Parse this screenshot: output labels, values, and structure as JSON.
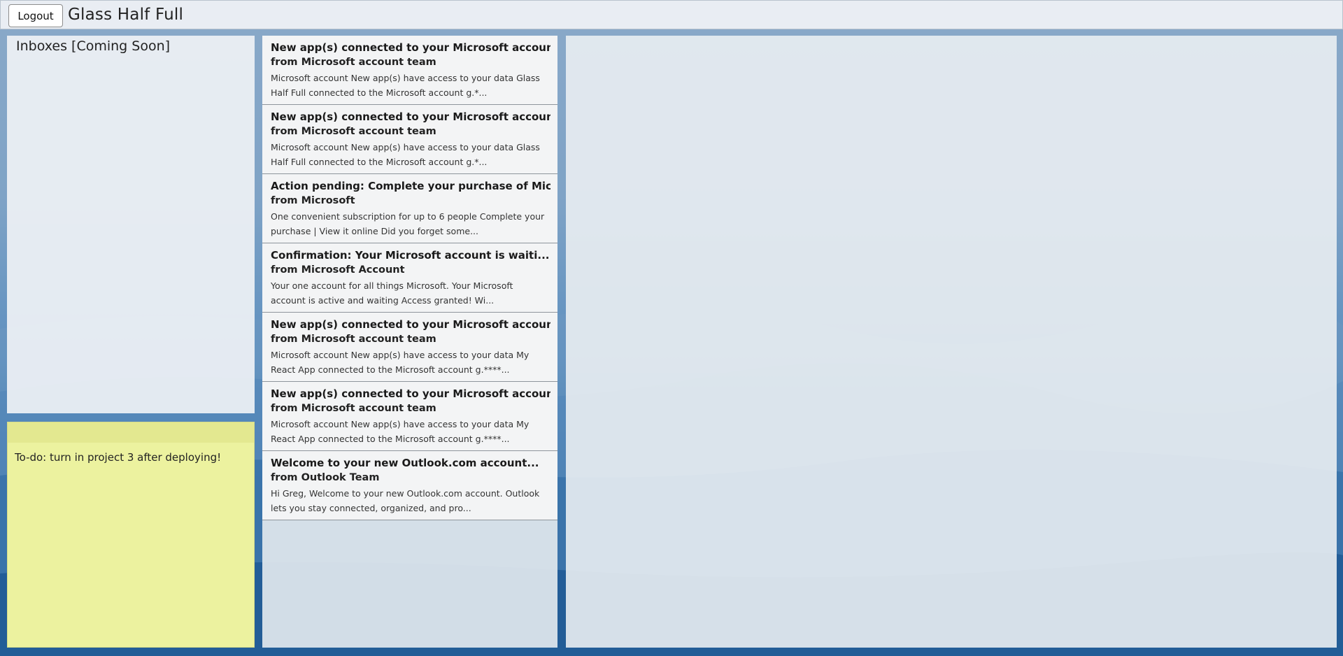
{
  "header": {
    "logout_label": "Logout",
    "app_title": "Glass Half Full"
  },
  "inboxes": {
    "title": "Inboxes [Coming Soon]"
  },
  "sticky_note": {
    "text": "To-do: turn in project 3 after deploying!"
  },
  "emails": [
    {
      "subject": "New app(s) connected to your Microsoft accoun...",
      "from": "from Microsoft account team",
      "preview": "Microsoft account New app(s) have access to your data Glass Half Full connected to the Microsoft account g.*..."
    },
    {
      "subject": "New app(s) connected to your Microsoft accoun...",
      "from": "from Microsoft account team",
      "preview": "Microsoft account New app(s) have access to your data Glass Half Full connected to the Microsoft account g.*..."
    },
    {
      "subject": "Action pending: Complete your purchase of Mic...",
      "from": "from Microsoft",
      "preview": "One convenient subscription for up to 6 people Complete your purchase | View it online Did you forget some..."
    },
    {
      "subject": "Confirmation: Your Microsoft account is waiti...",
      "from": "from Microsoft Account",
      "preview": "Your one account for all things Microsoft. Your Microsoft account is active and waiting Access granted! Wi..."
    },
    {
      "subject": "New app(s) connected to your Microsoft accoun...",
      "from": "from Microsoft account team",
      "preview": "Microsoft account New app(s) have access to your data My React App connected to the Microsoft account g.****..."
    },
    {
      "subject": "New app(s) connected to your Microsoft accoun...",
      "from": "from Microsoft account team",
      "preview": "Microsoft account New app(s) have access to your data My React App connected to the Microsoft account g.****..."
    },
    {
      "subject": "Welcome to your new Outlook.com account...",
      "from": "from Outlook Team",
      "preview": "Hi Greg, Welcome to your new Outlook.com account. Outlook lets you stay connected, organized, and pro..."
    }
  ],
  "colors": {
    "sticky_note": "#ecf29f",
    "panel_background": "#eef1f5",
    "background_blue": "#2f6fa8"
  }
}
